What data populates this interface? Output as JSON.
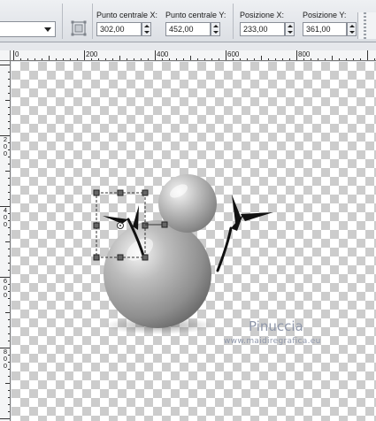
{
  "toolbar": {
    "dropdown_value": "",
    "fields": [
      {
        "label": "Punto centrale X:",
        "value": "302,00"
      },
      {
        "label": "Punto centrale Y:",
        "value": "452,00"
      },
      {
        "label": "Posizione X:",
        "value": "233,00"
      },
      {
        "label": "Posizione Y:",
        "value": "361,00"
      }
    ]
  },
  "ruler_top": {
    "labels": [
      "0",
      "200",
      "400",
      "600",
      "800"
    ]
  },
  "ruler_left": {
    "labels": [
      "2\n0\n0",
      "4\n0\n0",
      "6\n0\n0",
      "8\n0\n0"
    ]
  },
  "watermark": {
    "name": "Pinuccia",
    "site": "www.maidiregrafica.eu"
  },
  "colors": {
    "canvas_check": "#cccccc",
    "selection_handle": "#555555"
  }
}
